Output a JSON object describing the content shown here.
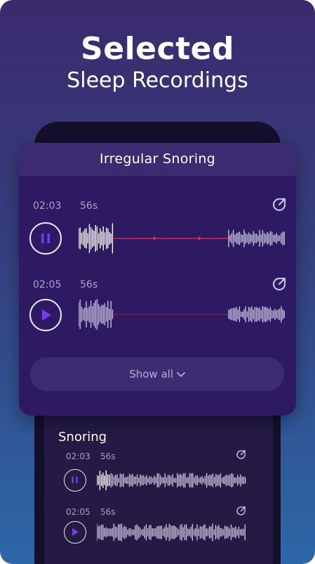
{
  "hero": {
    "title": "Selected",
    "subtitle": "Sleep Recordings"
  },
  "card": {
    "title": "Irregular Snoring",
    "recordings": [
      {
        "time": "02:03",
        "duration": "56s",
        "state": "playing"
      },
      {
        "time": "02:05",
        "duration": "56s",
        "state": "paused"
      }
    ],
    "show_all_label": "Show all"
  },
  "section": {
    "title": "Snoring",
    "recordings": [
      {
        "time": "02:03",
        "duration": "56s",
        "state": "playing"
      },
      {
        "time": "02:05",
        "duration": "56s",
        "state": "paused"
      }
    ]
  },
  "colors": {
    "accent": "#7c3aed",
    "progress": "#e0214a",
    "wave": "#c7c2db"
  }
}
